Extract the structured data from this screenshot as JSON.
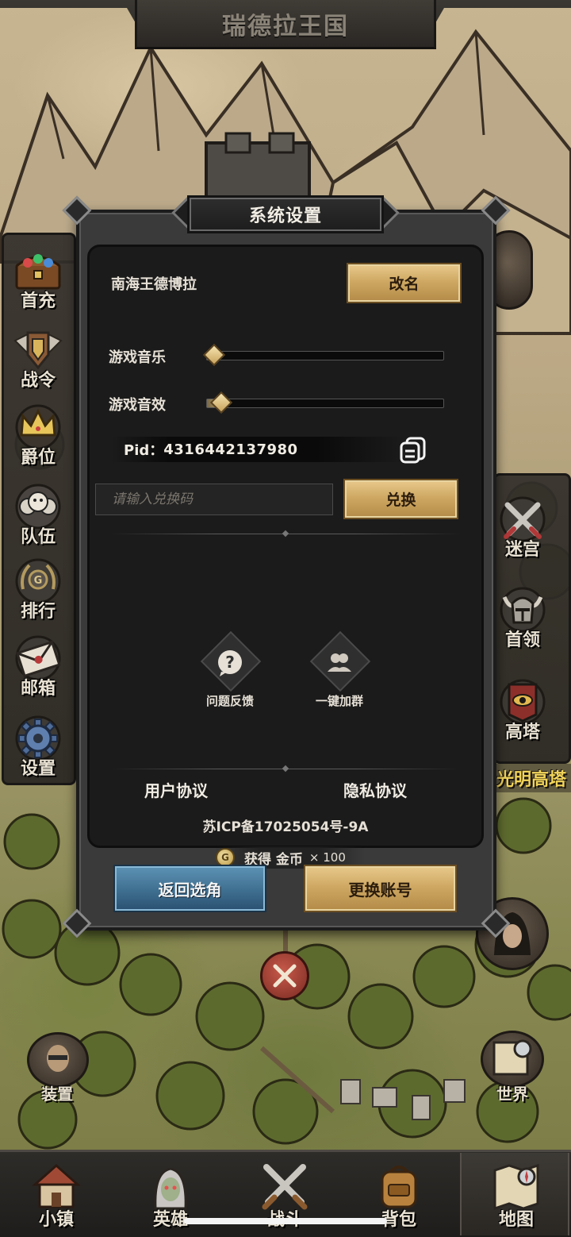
{
  "title_banner": {
    "text": "瑞德拉王国"
  },
  "left_menu": [
    {
      "label": "首充",
      "icon": "treasure-chest-icon"
    },
    {
      "label": "战令",
      "icon": "winged-shield-icon"
    },
    {
      "label": "爵位",
      "icon": "crown-icon"
    },
    {
      "label": "队伍",
      "icon": "team-faces-icon"
    },
    {
      "label": "排行",
      "icon": "laurel-ranking-icon"
    },
    {
      "label": "邮箱",
      "icon": "envelope-icon"
    },
    {
      "label": "设置",
      "icon": "gear-icon"
    }
  ],
  "right_menu": [
    {
      "label": "迷宫",
      "icon": "crossed-swords-icon"
    },
    {
      "label": "首领",
      "icon": "horned-helmet-icon"
    },
    {
      "label": "高塔",
      "icon": "eye-banner-icon"
    }
  ],
  "right_strip_text": "光明高塔",
  "dialog": {
    "title": "系统设置",
    "player_name": "南海王德博拉",
    "rename_label": "改名",
    "music_label": "游戏音乐",
    "music_level": 0.03,
    "sfx_label": "游戏音效",
    "sfx_level": 0.06,
    "pid_label": "Pid：",
    "pid_value": "4316442137980",
    "redeem_placeholder": "请输入兑换码",
    "redeem_label": "兑换",
    "feedback_label": "问题反馈",
    "join_group_label": "一键加群",
    "user_agreement": "用户协议",
    "privacy_agreement": "隐私协议",
    "icp": "苏ICP备17025054号-9A",
    "back_label": "返回选角",
    "switch_account_label": "更换账号"
  },
  "reward_toast": {
    "text": "获得 金币",
    "qty": "× 100",
    "coin_glyph": "G"
  },
  "map_icons": {
    "equip_label": "装置",
    "world_label": "世界"
  },
  "bottom_nav": [
    {
      "label": "小镇",
      "icon": "town-house-icon",
      "active": false
    },
    {
      "label": "英雄",
      "icon": "elf-hero-icon",
      "active": false
    },
    {
      "label": "战斗",
      "icon": "crossed-swords-icon",
      "active": false
    },
    {
      "label": "背包",
      "icon": "backpack-icon",
      "active": false
    },
    {
      "label": "地图",
      "icon": "map-scroll-icon",
      "active": true
    }
  ],
  "colors": {
    "gold_button": "#cfa964",
    "blue_button": "#3f6f90",
    "dialog_bg": "#1b1b1b",
    "highlight_text": "#f1d45a"
  }
}
